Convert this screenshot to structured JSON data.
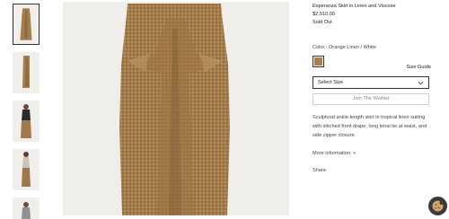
{
  "product": {
    "title": "Esperanza Skirt in Linen and Viscose",
    "price": "$2,910.00",
    "status": "Sold Out",
    "color_label": "Color : Orange Linen / White",
    "swatch_color": "#a9804e",
    "size_guide": "Size Guide",
    "size_select": "Select Size",
    "waitlist_button": "Join The Waitlist",
    "description_lines": [
      "Sculptural ankle-length skirt in tropical linen suiting",
      "with stitched front drape, long tonal tie at waist, and",
      "side zipper closure."
    ],
    "more_info": "More information",
    "more_info_icon": "+",
    "share": "Share"
  },
  "gallery": {
    "thumbnails": [
      {
        "name": "thumb-skirt-front",
        "active": true
      },
      {
        "name": "thumb-skirt-side",
        "active": false
      },
      {
        "name": "thumb-model-front",
        "active": false
      },
      {
        "name": "thumb-model-back",
        "active": false
      },
      {
        "name": "thumb-model-partial",
        "active": false
      }
    ]
  },
  "icons": {
    "select_chevron": "chevron-down-icon",
    "cookie": "cookie-icon"
  }
}
